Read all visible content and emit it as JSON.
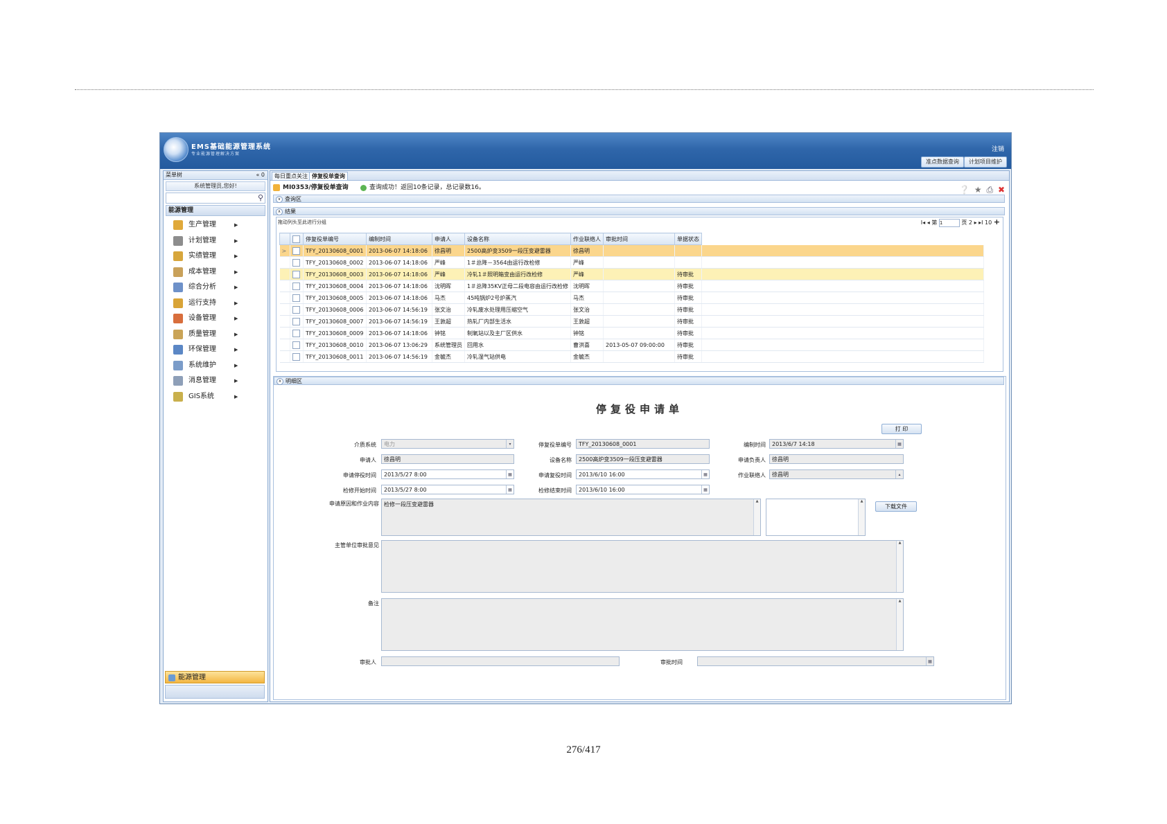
{
  "page_number": "276/417",
  "app": {
    "title": "EMS基础能源管理系统",
    "subtitle": "专业能源管理解决方案",
    "logout": "注销",
    "quick_buttons": [
      "准点数据查询",
      "计划项目维护"
    ]
  },
  "sidebar": {
    "header": "菜单树",
    "pin": "« 0",
    "welcome": "系统管理员,您好!",
    "group": "能源管理",
    "items": [
      "生产管理",
      "计划管理",
      "实绩管理",
      "成本管理",
      "综合分析",
      "运行支持",
      "设备管理",
      "质量管理",
      "环保管理",
      "系统维护",
      "消息管理",
      "GIS系统"
    ],
    "item_colors": [
      "#e0a93a",
      "#8d8d8d",
      "#d7a63c",
      "#c9a15a",
      "#6e91c9",
      "#d9a437",
      "#d86e3c",
      "#caa457",
      "#5b87c5",
      "#7b9cc9",
      "#8e9fb8",
      "#c9b04c"
    ],
    "bottom_tab": "能源管理"
  },
  "tabs": [
    "每日重点关注",
    "停复役单查询"
  ],
  "breadcrumb": {
    "code": "MI0353/停复役单查询",
    "message": "查询成功！返回10条记录，总记录数16。"
  },
  "sections": {
    "query": "查询区",
    "result": "结果",
    "detail": "明细区"
  },
  "grid": {
    "hint": "拖动列头至此进行分组",
    "pager": {
      "first": "I◂",
      "prev": "◂",
      "page_label": "第",
      "page_value": "1",
      "page_total": "页 2",
      "next": "▸",
      "last": "▸I",
      "page_size": "10",
      "add": "+"
    },
    "columns": [
      "停复役单编号",
      "编制时间",
      "申请人",
      "设备名称",
      "作业联络人",
      "审批时间",
      "单据状态"
    ],
    "rows": [
      {
        "id": "TFY_20130608_0001",
        "time": "2013-06-07 14:18:06",
        "applicant": "徐昌明",
        "device": "2500高炉变3509一段压变避雷器",
        "contact": "徐昌明",
        "approve": "",
        "status": ""
      },
      {
        "id": "TFY_20130608_0002",
        "time": "2013-06-07 14:18:06",
        "applicant": "严峰",
        "device": "1＃总降－3564由运行改检修",
        "contact": "严峰",
        "approve": "",
        "status": ""
      },
      {
        "id": "TFY_20130608_0003",
        "time": "2013-06-07 14:18:06",
        "applicant": "严峰",
        "device": "冷轧1＃照明箱变由运行改检修",
        "contact": "严峰",
        "approve": "",
        "status": "待审批"
      },
      {
        "id": "TFY_20130608_0004",
        "time": "2013-06-07 14:18:06",
        "applicant": "沈明晖",
        "device": "1＃总降35KV正母二段电容由运行改检修",
        "contact": "沈明晖",
        "approve": "",
        "status": "待审批"
      },
      {
        "id": "TFY_20130608_0005",
        "time": "2013-06-07 14:18:06",
        "applicant": "马杰",
        "device": "45吨锅炉2号炉蒸汽",
        "contact": "马杰",
        "approve": "",
        "status": "待审批"
      },
      {
        "id": "TFY_20130608_0006",
        "time": "2013-06-07 14:56:19",
        "applicant": "张文治",
        "device": "冷轧废水处理用压缩空气",
        "contact": "张文治",
        "approve": "",
        "status": "待审批"
      },
      {
        "id": "TFY_20130608_0007",
        "time": "2013-06-07 14:56:19",
        "applicant": "王敦超",
        "device": "热轧厂内部生活水",
        "contact": "王敦超",
        "approve": "",
        "status": "待审批"
      },
      {
        "id": "TFY_20130608_0009",
        "time": "2013-06-07 14:18:06",
        "applicant": "钟铭",
        "device": "制氧站以及主厂区供水",
        "contact": "钟铭",
        "approve": "",
        "status": "待审批"
      },
      {
        "id": "TFY_20130608_0010",
        "time": "2013-06-07 13:06:29",
        "applicant": "系统管理员",
        "device": "回用水",
        "contact": "曹洪喜",
        "approve": "2013-05-07 09:00:00",
        "status": "待审批"
      },
      {
        "id": "TFY_20130608_0011",
        "time": "2013-06-07 14:56:19",
        "applicant": "金毓杰",
        "device": "冷轧湿气站供电",
        "contact": "金毓杰",
        "approve": "",
        "status": "待审批"
      }
    ]
  },
  "form": {
    "title": "停复役申请单",
    "print_button": "打 印",
    "download_button": "下载文件",
    "labels": {
      "medium": "介质系统",
      "order_no": "停复役单编号",
      "created": "编制时间",
      "applicant": "申请人",
      "device": "设备名称",
      "owner": "申请负责人",
      "stop_time": "申请停役时间",
      "resume_time": "申请复役时间",
      "contact": "作业联络人",
      "repair_start": "检修开始时间",
      "repair_end": "检修结束时间",
      "reason": "申请原因和作业内容",
      "opinion": "主管单位审批意见",
      "remark": "备注",
      "approver": "审批人",
      "approve_time": "审批时间"
    },
    "values": {
      "medium": "电力",
      "order_no": "TFY_20130608_0001",
      "created": "2013/6/7 14:18",
      "applicant": "徐昌明",
      "device": "2500高炉变3509一段压变避雷器",
      "owner": "徐昌明",
      "stop_time": "2013/5/27 8:00",
      "resume_time": "2013/6/10 16:00",
      "contact": "徐昌明",
      "repair_start": "2013/5/27 8:00",
      "repair_end": "2013/6/10 16:00",
      "reason": "检修一段压变避雷器",
      "opinion": "",
      "remark": "",
      "approver": "",
      "approve_time": ""
    }
  }
}
